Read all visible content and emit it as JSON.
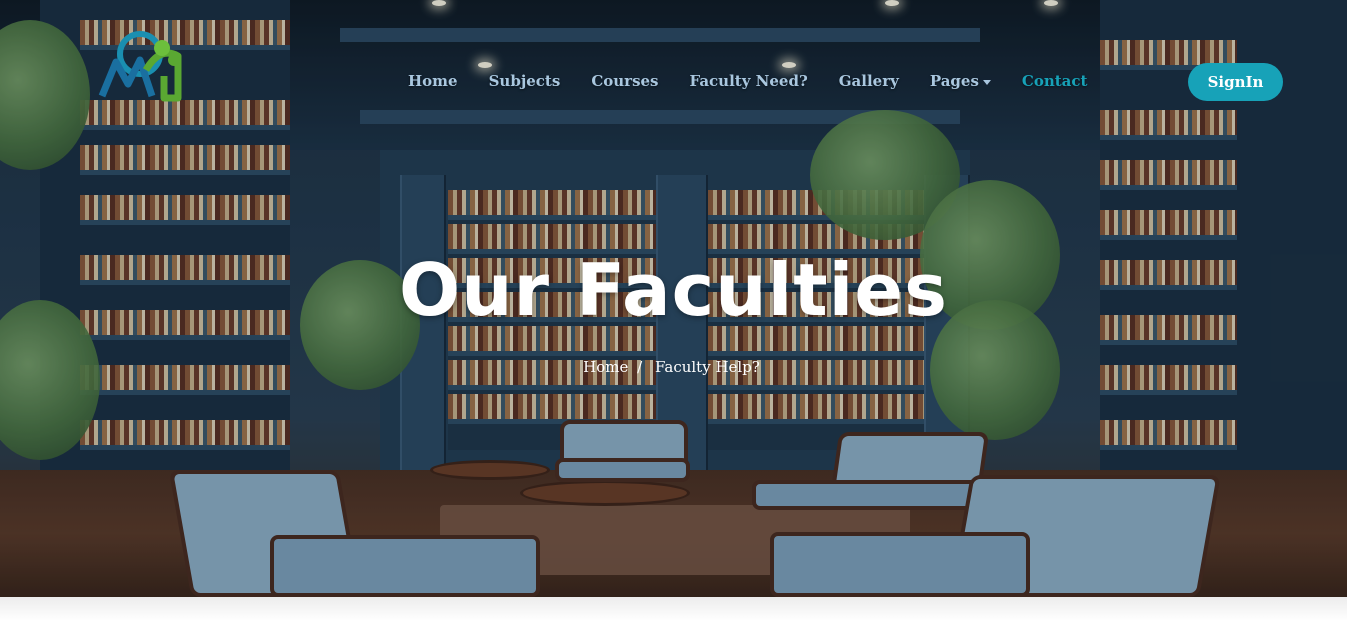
{
  "nav": {
    "items": [
      {
        "label": "Home"
      },
      {
        "label": "Subjects"
      },
      {
        "label": "Courses"
      },
      {
        "label": "Faculty Need?"
      },
      {
        "label": "Gallery"
      },
      {
        "label": "Pages"
      },
      {
        "label": "Contact"
      }
    ],
    "signin_label": "SignIn"
  },
  "hero": {
    "title": "Our Faculties",
    "breadcrumb": {
      "home": "Home",
      "separator": "/",
      "current": "Faculty Help?"
    }
  },
  "colors": {
    "accent": "#17a2b8",
    "nav_text": "#a9c7df",
    "title_text": "#ffffff"
  },
  "icons": {
    "logo": "brand-logo",
    "pages_dropdown": "caret-down-icon"
  }
}
